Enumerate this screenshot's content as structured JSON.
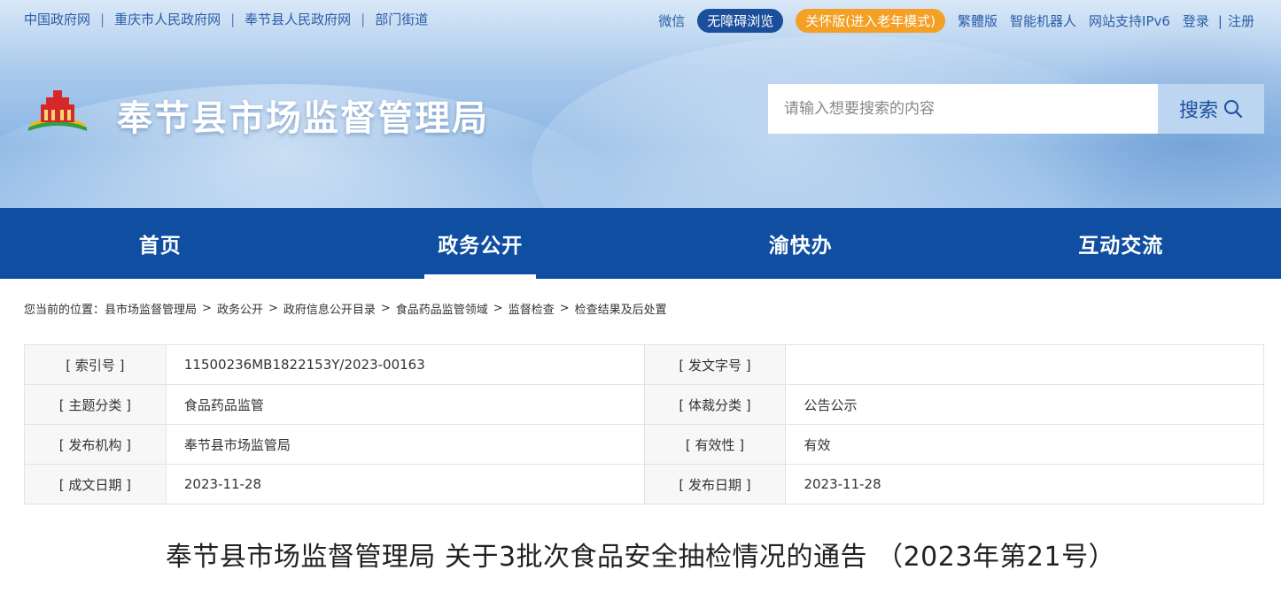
{
  "top_links": [
    "中国政府网",
    "重庆市人民政府网",
    "奉节县人民政府网",
    "部门街道"
  ],
  "top_right": {
    "wechat": "微信",
    "accessible": "无障碍浏览",
    "elder": "关怀版(进入老年模式)",
    "traditional": "繁體版",
    "robot": "智能机器人",
    "ipv6": "网站支持IPv6",
    "login": "登录",
    "separator": "|",
    "register": "注册"
  },
  "site_title": "奉节县市场监督管理局",
  "search": {
    "placeholder": "请输入想要搜索的内容",
    "button_label": "搜索"
  },
  "nav": {
    "items": [
      {
        "label": "首页"
      },
      {
        "label": "政务公开"
      },
      {
        "label": "渝快办"
      },
      {
        "label": "互动交流"
      }
    ],
    "active_index": 1
  },
  "breadcrumb": {
    "prefix": "您当前的位置：",
    "items": [
      "县市场监督管理局",
      "政务公开",
      "政府信息公开目录",
      "食品药品监管领域",
      "监督检查",
      "检查结果及后处置"
    ],
    "separator": ">"
  },
  "meta": {
    "rows": [
      {
        "k1": "[ 索引号 ]",
        "v1": "11500236MB1822153Y/2023-00163",
        "k2": "[ 发文字号 ]",
        "v2": ""
      },
      {
        "k1": "[ 主题分类 ]",
        "v1": "食品药品监管",
        "k2": "[ 体裁分类 ]",
        "v2": "公告公示"
      },
      {
        "k1": "[ 发布机构 ]",
        "v1": "奉节县市场监管局",
        "k2": "[ 有效性 ]",
        "v2": "有效"
      },
      {
        "k1": "[ 成文日期 ]",
        "v1": "2023-11-28",
        "k2": "[ 发布日期 ]",
        "v2": "2023-11-28"
      }
    ]
  },
  "article_title": "奉节县市场监督管理局 关于3批次食品安全抽检情况的通告 （2023年第21号）",
  "colors": {
    "nav_bg": "#0f4ea0",
    "accessible_pill": "#1b4f9c",
    "elder_pill": "#f4a024"
  }
}
